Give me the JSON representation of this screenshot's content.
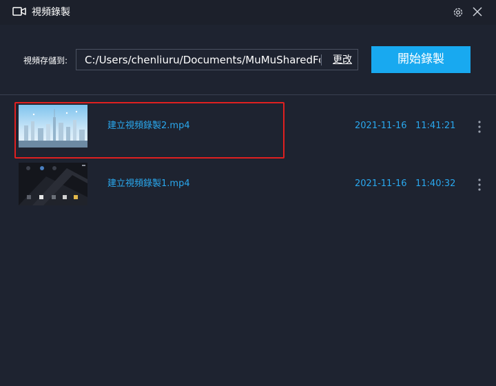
{
  "window": {
    "title": "視頻錄製",
    "title_icon": "video-camera-icon",
    "settings_icon": "gear-icon",
    "close_icon": "close-icon"
  },
  "toolbar": {
    "path_label": "視頻存儲到:",
    "path_value": "C:/Users/chenliuru/Documents/MuMuSharedFolder",
    "change_label": "更改",
    "record_label": "開始錄製"
  },
  "colors": {
    "accent": "#18a9f0",
    "link": "#2aa8ee",
    "highlight": "#e02020",
    "background": "#1e2330"
  },
  "recordings": [
    {
      "name": "建立視頻錄製2.mp4",
      "date": "2021-11-16",
      "time": "11:41:21",
      "thumbnail": "city-skyline-thumbnail",
      "highlighted": true
    },
    {
      "name": "建立視頻錄製1.mp4",
      "date": "2021-11-16",
      "time": "11:40:32",
      "thumbnail": "android-home-thumbnail",
      "highlighted": false
    }
  ]
}
